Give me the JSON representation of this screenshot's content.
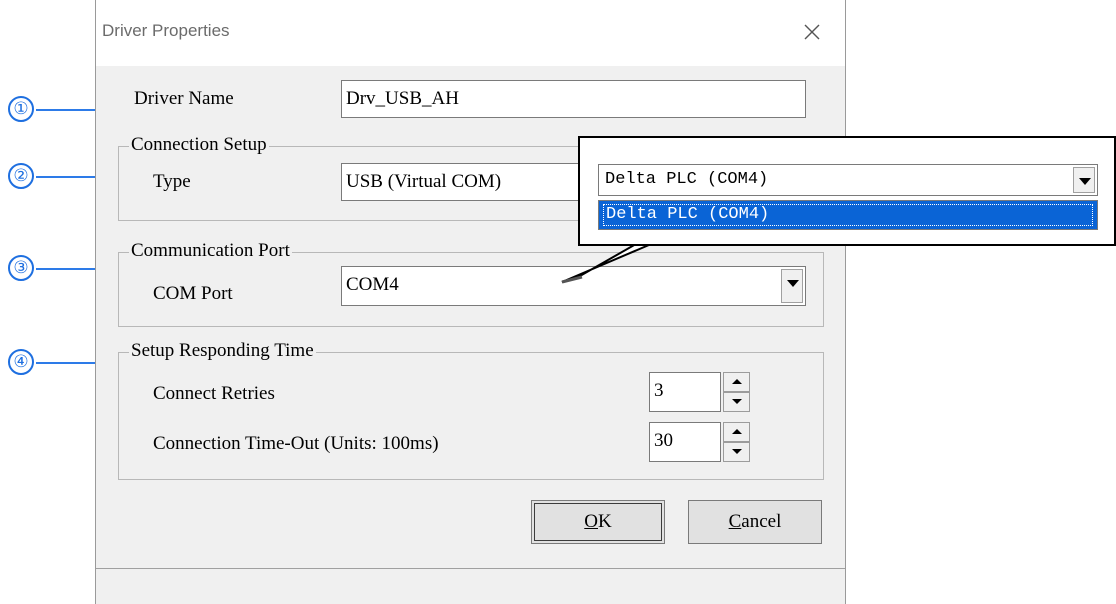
{
  "dialog": {
    "title": "Driver Properties",
    "close_glyph": "×"
  },
  "driver_name": {
    "label": "Driver Name",
    "value": "Drv_USB_AH"
  },
  "connection_setup": {
    "legend": "Connection Setup",
    "type_label": "Type",
    "type_value": "USB (Virtual COM)"
  },
  "communication_port": {
    "legend": "Communication Port",
    "com_label": "COM Port",
    "com_value": "COM4"
  },
  "responding_time": {
    "legend": "Setup Responding Time",
    "retries_label": "Connect Retries",
    "retries_value": "3",
    "timeout_label": "Connection Time-Out (Units: 100ms)",
    "timeout_value": "30"
  },
  "buttons": {
    "ok_mnemonic": "O",
    "ok_rest": "K",
    "cancel_mnemonic": "C",
    "cancel_rest": "ancel"
  },
  "popup": {
    "combo_value": "Delta PLC (COM4)",
    "list_item": "Delta PLC (COM4)"
  },
  "markers": [
    "①",
    "②",
    "③",
    "④"
  ],
  "colors": {
    "accent": "#1e6fe0",
    "selection": "#0a64d6",
    "dialog_bg": "#f0f0f0"
  },
  "icons": [
    "close-icon",
    "dropdown-arrow-icon",
    "spin-up-icon",
    "spin-down-icon"
  ]
}
